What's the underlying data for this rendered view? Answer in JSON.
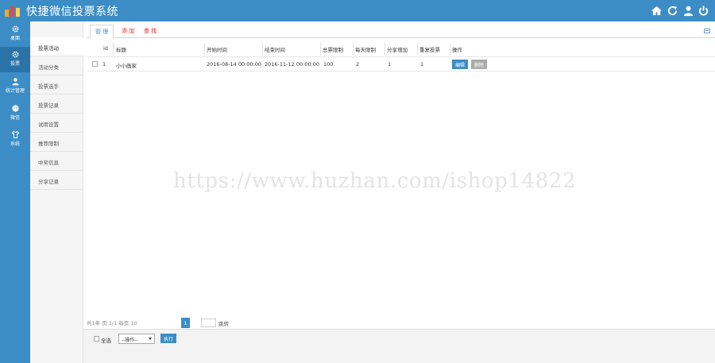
{
  "app": {
    "title": "快捷微信投票系统"
  },
  "header_icons": [
    "home-icon",
    "refresh-icon",
    "user-icon",
    "power-icon"
  ],
  "sidebar": {
    "items": [
      {
        "label": "桌面",
        "icon": "gear-icon",
        "active": false
      },
      {
        "label": "投票",
        "icon": "gear-icon",
        "active": true
      },
      {
        "label": "统计管理",
        "icon": "user-icon",
        "active": false
      },
      {
        "label": "微信",
        "icon": "chat-icon",
        "active": false
      },
      {
        "label": "系统",
        "icon": "shirt-icon",
        "active": false
      }
    ]
  },
  "submenu": {
    "items": [
      {
        "label": "投票活动",
        "active": true
      },
      {
        "label": "活动分类",
        "active": false
      },
      {
        "label": "投票选手",
        "active": false
      },
      {
        "label": "投票记录",
        "active": false
      },
      {
        "label": "试用设置",
        "active": false
      },
      {
        "label": "推荐限制",
        "active": false
      },
      {
        "label": "中奖信息",
        "active": false
      },
      {
        "label": "分享记录",
        "active": false
      }
    ]
  },
  "tabs": [
    {
      "label": "管 理",
      "active": true
    },
    {
      "label": "添 加",
      "active": false
    },
    {
      "label": "查 找",
      "active": false
    }
  ],
  "table": {
    "columns": [
      "id",
      "标题",
      "开始时间",
      "结束时间",
      "总票限制",
      "每天限制",
      "分享增加",
      "重复投票",
      "操作"
    ],
    "rows": [
      {
        "id": "1",
        "title": "小小画家",
        "start": "2016-08-14 00:00:00",
        "end": "2016-11-12 00:00:00",
        "total_limit": "100",
        "daily_limit": "2",
        "share_add": "1",
        "repeat": "1",
        "actions": [
          "编辑",
          "删除"
        ]
      }
    ]
  },
  "watermark": "https://www.huzhan.com/ishop14822",
  "pager": {
    "summary": "共1条 页 1/1 每页 10",
    "current_page": "1",
    "goto_label": "跳转"
  },
  "footer": {
    "select_all": "全选",
    "operation_select": "--操作--",
    "execute": "执行"
  },
  "colors": {
    "primary": "#3c8dc5",
    "tab_red": "#dd2222"
  }
}
